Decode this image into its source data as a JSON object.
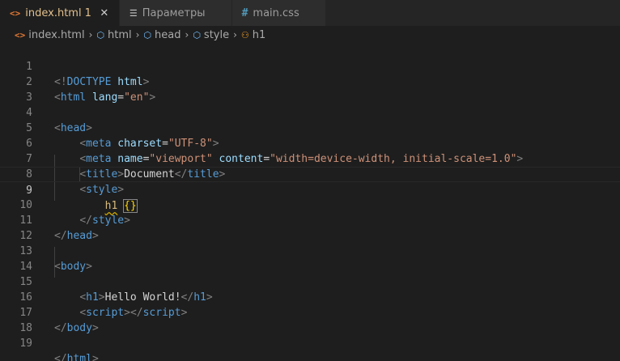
{
  "tabs": [
    {
      "label": "index.html",
      "badge": "1",
      "icon": "html-file-icon",
      "active": true,
      "close": "✕"
    },
    {
      "label": "Параметры",
      "icon": "settings-file-icon",
      "active": false
    },
    {
      "label": "main.css",
      "icon": "css-file-icon",
      "active": false
    }
  ],
  "breadcrumb": {
    "items": [
      "index.html",
      "html",
      "head",
      "style",
      "h1"
    ],
    "separator": "›"
  },
  "editor": {
    "line_numbers": [
      "1",
      "2",
      "3",
      "4",
      "5",
      "6",
      "7",
      "8",
      "9",
      "10",
      "11",
      "12",
      "13",
      "14",
      "15",
      "16",
      "17",
      "18",
      "19"
    ],
    "current_line": 9,
    "doctype": {
      "open": "<!",
      "keyword": "DOCTYPE",
      "name": "html",
      "close": ">"
    },
    "html_open": {
      "tag": "html",
      "attr": "lang",
      "value": "\"en\""
    },
    "head_tag": "head",
    "meta_tag": "meta",
    "meta_charset": {
      "attr": "charset",
      "value": "\"UTF-8\""
    },
    "meta_viewport": {
      "attr1": "name",
      "value1": "\"viewport\"",
      "attr2": "content",
      "value2": "\"width=device-width, initial-scale=1.0\""
    },
    "title_tag": "title",
    "title_text": "Document",
    "style_tag": "style",
    "selector": "h1",
    "braces": "{}",
    "body_tag": "body",
    "h1_tag": "h1",
    "h1_text": "Hello World!",
    "script_tag": "script",
    "html_tag": "html",
    "lt": "<",
    "gt": ">",
    "lt_slash": "</",
    "eq": "="
  },
  "colors": {
    "background": "#1e1e1e",
    "tab_active_text": "#e2c08d",
    "tag": "#569cd6",
    "attribute": "#9cdcfe",
    "string": "#ce9178",
    "selector": "#d7ba7d"
  }
}
